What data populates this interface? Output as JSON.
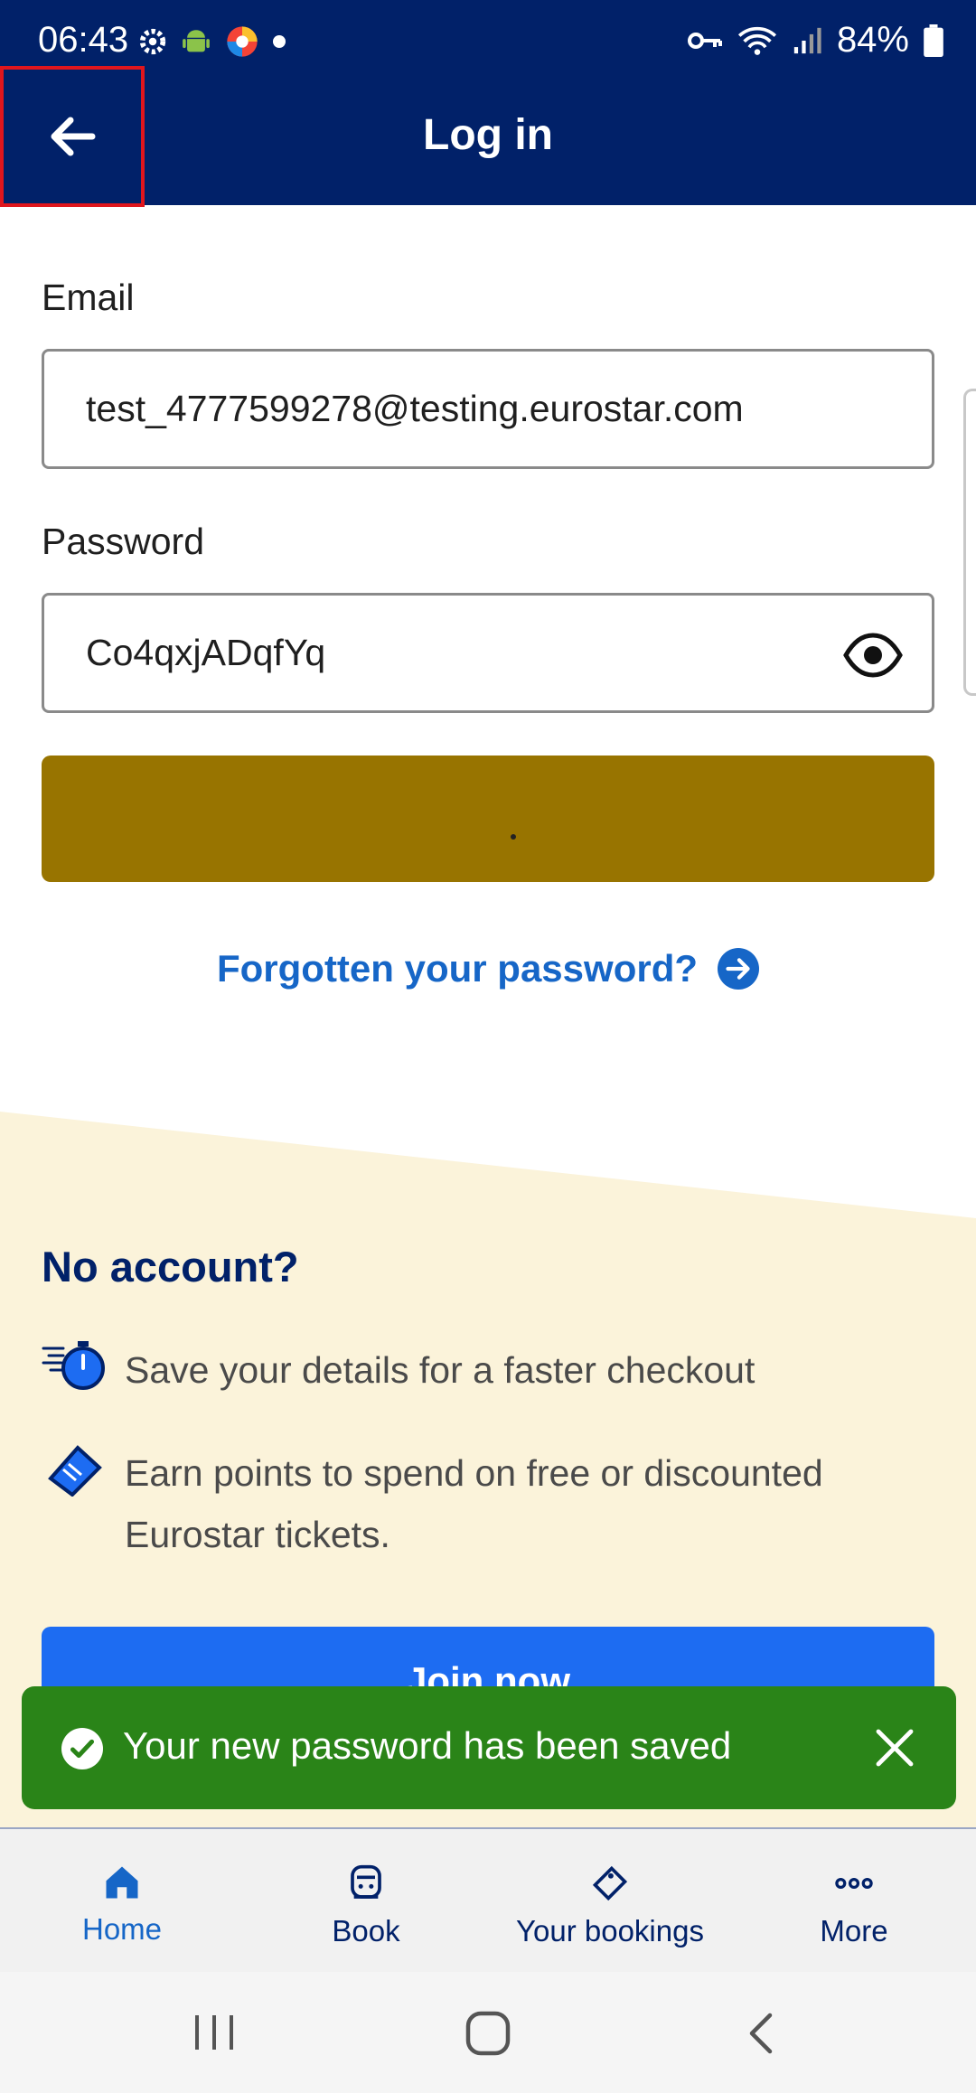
{
  "status_bar": {
    "time": "06:43",
    "battery": "84%",
    "icons_left": [
      "settings-icon",
      "android-icon",
      "browser-icon",
      "dot-icon"
    ],
    "icons_right": [
      "key-icon",
      "wifi-icon",
      "signal-icon",
      "battery-icon"
    ]
  },
  "header": {
    "title": "Log in",
    "back_icon": "arrow-left-icon"
  },
  "form": {
    "email_label": "Email",
    "email_value": "test_4777599278@testing.eurostar.com",
    "password_label": "Password",
    "password_value": "Co4qxjADqfYq",
    "show_password_icon": "eye-icon",
    "submit_state": "loading",
    "forgot_text": "Forgotten your password?"
  },
  "account": {
    "heading": "No account?",
    "benefits": [
      {
        "icon": "stopwatch-icon",
        "text": "Save your details for a faster checkout"
      },
      {
        "icon": "ticket-icon",
        "text": "Earn points to spend on free or discounted Eurostar tickets."
      }
    ],
    "join_label": "Join now"
  },
  "toast": {
    "message": "Your new password has been saved",
    "icon": "check-circle-icon"
  },
  "bottom_nav": [
    {
      "label": "Home",
      "icon": "home-icon",
      "active": true
    },
    {
      "label": "Book",
      "icon": "train-icon",
      "active": false
    },
    {
      "label": "Your bookings",
      "icon": "ticket-icon",
      "active": false
    },
    {
      "label": "More",
      "icon": "more-icon",
      "active": false
    }
  ],
  "colors": {
    "header_bg": "#012169",
    "submit_bg": "#987400",
    "link": "#1666c7",
    "cream": "#fbf3da",
    "join_bg": "#1d6cf2",
    "toast_bg": "#2a8418",
    "highlight": "#e0161d"
  }
}
